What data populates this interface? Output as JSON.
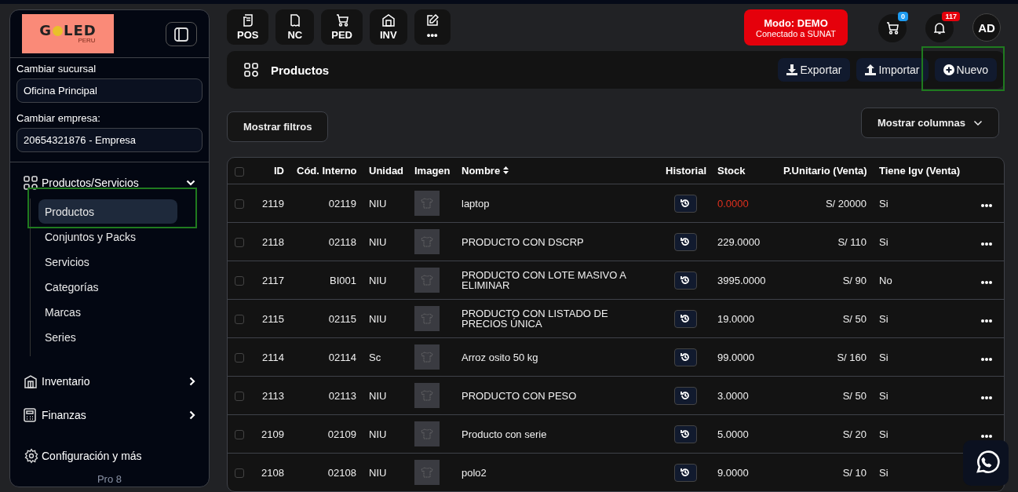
{
  "sidebar": {
    "logo": {
      "left": "G",
      "right": "LED",
      "sub": "PERU"
    },
    "branch": {
      "label": "Cambiar sucursal",
      "value": "Oficina Principal"
    },
    "company": {
      "label": "Cambiar empresa:",
      "value": "20654321876 - Empresa"
    },
    "menu": [
      {
        "label": "Productos/Servicios",
        "kind": "group",
        "expanded": true,
        "children": [
          {
            "label": "Productos",
            "selected": true,
            "annotated": true
          },
          {
            "label": "Conjuntos y Packs",
            "selected": false,
            "annotated": false
          },
          {
            "label": "Servicios",
            "selected": false,
            "annotated": false
          },
          {
            "label": "Categorías",
            "selected": false,
            "annotated": false
          },
          {
            "label": "Marcas",
            "selected": false,
            "annotated": false
          },
          {
            "label": "Series",
            "selected": false,
            "annotated": false
          }
        ]
      },
      {
        "label": "Inventario",
        "kind": "group",
        "expanded": false
      },
      {
        "label": "Finanzas",
        "kind": "group",
        "expanded": false
      },
      {
        "label": "Configuración y más",
        "kind": "link"
      }
    ],
    "version": "Pro 8"
  },
  "quick_actions": [
    "POS",
    "NC",
    "PED",
    "INV",
    "•••"
  ],
  "mode": {
    "title": "Modo: DEMO",
    "subtitle": "Conectado a SUNAT"
  },
  "cart_count": "0",
  "notification_count": "117",
  "avatar": "AD",
  "page_title": "Productos",
  "actions": [
    {
      "label": "Exportar",
      "kind": "export",
      "annotated": false
    },
    {
      "label": "Importar",
      "kind": "import",
      "annotated": false
    },
    {
      "label": "Nuevo",
      "kind": "new",
      "annotated": true
    }
  ],
  "filters_button": "Mostrar filtros",
  "columns_button": "Mostrar columnas",
  "table": {
    "header_checked": false,
    "columns": [
      "ID",
      "Cód. Interno",
      "Unidad",
      "Imagen",
      "Nombre",
      "Historial",
      "Stock",
      "P.Unitario (Venta)",
      "Tiene Igv (Venta)"
    ],
    "rows": [
      {
        "checked": false,
        "id": "2119",
        "code": "02119",
        "unit": "NIU",
        "name": "laptop",
        "stock": "0.0000",
        "stock_low": true,
        "price": "S/ 20000",
        "igv": "Si"
      },
      {
        "checked": false,
        "id": "2118",
        "code": "02118",
        "unit": "NIU",
        "name": "PRODUCTO CON DSCRP",
        "stock": "229.0000",
        "stock_low": false,
        "price": "S/ 110",
        "igv": "Si"
      },
      {
        "checked": false,
        "id": "2117",
        "code": "BI001",
        "unit": "NIU",
        "name": "PRODUCTO CON LOTE MASIVO A ELIMINAR",
        "stock": "3995.0000",
        "stock_low": false,
        "price": "S/ 90",
        "igv": "No"
      },
      {
        "checked": false,
        "id": "2115",
        "code": "02115",
        "unit": "NIU",
        "name": "PRODUCTO CON LISTADO DE PRECIOS ÚNICA",
        "stock": "19.0000",
        "stock_low": false,
        "price": "S/ 50",
        "igv": "Si"
      },
      {
        "checked": false,
        "id": "2114",
        "code": "02114",
        "unit": "Sc",
        "name": "Arroz osito 50 kg",
        "stock": "99.0000",
        "stock_low": false,
        "price": "S/ 160",
        "igv": "Si"
      },
      {
        "checked": false,
        "id": "2113",
        "code": "02113",
        "unit": "NIU",
        "name": "PRODUCTO CON PESO",
        "stock": "3.0000",
        "stock_low": false,
        "price": "S/ 50",
        "igv": "Si"
      },
      {
        "checked": false,
        "id": "2109",
        "code": "02109",
        "unit": "NIU",
        "name": "Producto con serie",
        "stock": "5.0000",
        "stock_low": false,
        "price": "S/ 20",
        "igv": "Si"
      },
      {
        "checked": false,
        "id": "2108",
        "code": "02108",
        "unit": "NIU",
        "name": "polo2",
        "stock": "9.0000",
        "stock_low": false,
        "price": "S/ 10",
        "igv": "Si"
      }
    ]
  }
}
